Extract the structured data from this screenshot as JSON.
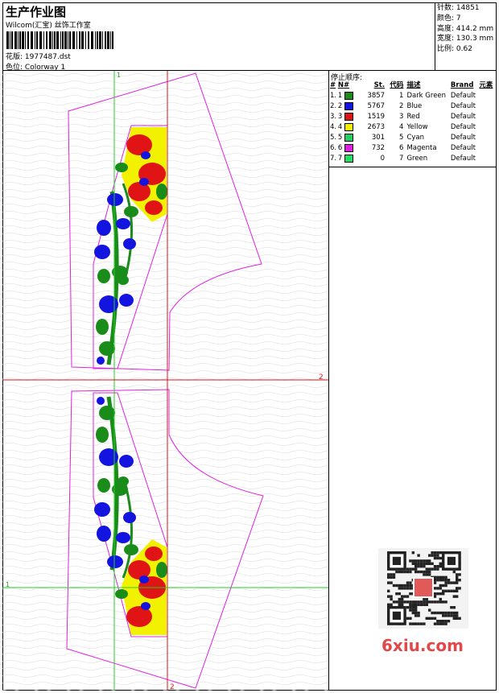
{
  "header": {
    "title": "生产作业图",
    "studio": "Wilcom(汇宝) 丝饰工作室",
    "design_label": "花版:",
    "design_file": "1977487.dst",
    "colorway_label": "色位:",
    "colorway": "Colorway 1"
  },
  "stats": [
    {
      "label": "针数:",
      "value": "14851"
    },
    {
      "label": "颜色:",
      "value": "7"
    },
    {
      "label": "高度:",
      "value": "414.2 mm"
    },
    {
      "label": "宽度:",
      "value": "130.3 mm"
    },
    {
      "label": "比例:",
      "value": "0.62"
    }
  ],
  "stop_sequence": {
    "title": "停止顺序:",
    "headers": {
      "index": "#",
      "num": "N#",
      "stitches": "St.",
      "code": "代码",
      "desc": "描述",
      "brand": "Brand",
      "element": "元素"
    },
    "rows": [
      {
        "index": "1.",
        "num": "1",
        "color": "#1a8c1a",
        "stitches": "3857",
        "code": "1",
        "desc": "Dark Green",
        "brand": "Default"
      },
      {
        "index": "2.",
        "num": "2",
        "color": "#1414e0",
        "stitches": "5767",
        "code": "2",
        "desc": "Blue",
        "brand": "Default"
      },
      {
        "index": "3.",
        "num": "3",
        "color": "#e01414",
        "stitches": "1519",
        "code": "3",
        "desc": "Red",
        "brand": "Default"
      },
      {
        "index": "4.",
        "num": "4",
        "color": "#f2f200",
        "stitches": "2673",
        "code": "4",
        "desc": "Yellow",
        "brand": "Default"
      },
      {
        "index": "5.",
        "num": "5",
        "color": "#20d060",
        "stitches": "301",
        "code": "5",
        "desc": "Cyan",
        "brand": "Default"
      },
      {
        "index": "6.",
        "num": "6",
        "color": "#e020e0",
        "stitches": "732",
        "code": "6",
        "desc": "Magenta",
        "brand": "Default"
      },
      {
        "index": "7.",
        "num": "7",
        "color": "#20e060",
        "stitches": "0",
        "code": "7",
        "desc": "Green",
        "brand": "Default"
      }
    ]
  },
  "guides": {
    "vertical_top": "1",
    "vertical_bottom": "2",
    "horizontal_left": "1",
    "horizontal_right": "2"
  },
  "watermark": "6xiu.com",
  "colors": {
    "outline": "#e020e0",
    "guide_green": "#20d020",
    "guide_red": "#e01414"
  },
  "icons": {
    "qr": "qr-code-icon",
    "barcode": "barcode-icon"
  }
}
